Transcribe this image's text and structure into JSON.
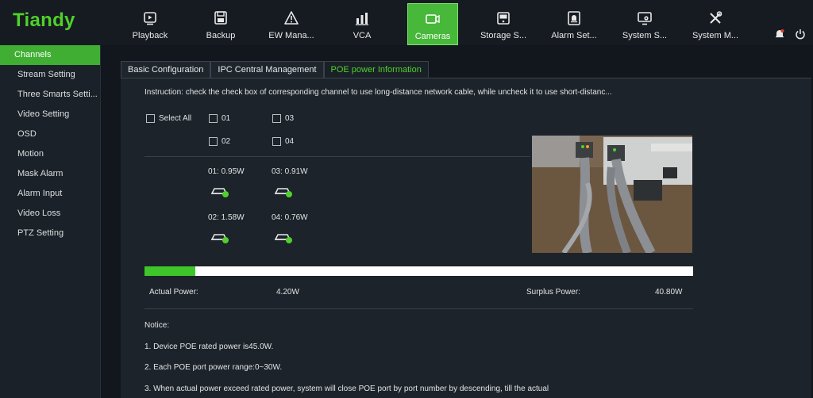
{
  "brand": {
    "logo": "Tiandy",
    "accent": "#4fd12a"
  },
  "nav": [
    {
      "label": "Playback",
      "icon": "playback-icon"
    },
    {
      "label": "Backup",
      "icon": "floppy-disk-icon"
    },
    {
      "label": "EW Mana...",
      "icon": "warning-triangle-icon"
    },
    {
      "label": "VCA",
      "icon": "vca-chart-icon"
    },
    {
      "label": "Cameras",
      "icon": "camera-icon",
      "active": true
    },
    {
      "label": "Storage S...",
      "icon": "storage-icon"
    },
    {
      "label": "Alarm Set...",
      "icon": "alarm-icon"
    },
    {
      "label": "System S...",
      "icon": "system-settings-icon"
    },
    {
      "label": "System M...",
      "icon": "tools-icon"
    }
  ],
  "top_right": {
    "notification_icon": "bell-icon",
    "power_icon": "power-icon"
  },
  "sidebar": [
    {
      "label": "Channels",
      "active": true
    },
    {
      "label": "Stream Setting"
    },
    {
      "label": "Three Smarts Setti..."
    },
    {
      "label": "Video Setting"
    },
    {
      "label": "OSD"
    },
    {
      "label": "Motion"
    },
    {
      "label": "Mask Alarm"
    },
    {
      "label": "Alarm Input"
    },
    {
      "label": "Video Loss"
    },
    {
      "label": "PTZ Setting"
    }
  ],
  "tabs": [
    {
      "label": "Basic Configuration"
    },
    {
      "label": "IPC Central Management"
    },
    {
      "label": "POE power Information",
      "active": true
    }
  ],
  "poe": {
    "instruction": "Instruction: check the check box of corresponding channel to use long-distance network cable, while uncheck it to use short-distanc...",
    "select_all": "Select All",
    "channels": [
      "01",
      "02",
      "03",
      "04"
    ],
    "ports": [
      {
        "label": "01:  0.95W"
      },
      {
        "label": "03:  0.91W"
      },
      {
        "label": "02:  1.58W"
      },
      {
        "label": "04:  0.76W"
      }
    ],
    "actual_power_label": "Actual Power:",
    "actual_power_value": "4.20W",
    "surplus_power_label": "Surplus Power:",
    "surplus_power_value": "40.80W",
    "usage_fraction": 0.0933,
    "notice_title": "Notice:",
    "notices": [
      "1. Device POE rated power is45.0W.",
      "2. Each POE port power range:0~30W.",
      "3. When actual power exceed rated power, system will close POE port by port number by descending, till the actual"
    ]
  }
}
